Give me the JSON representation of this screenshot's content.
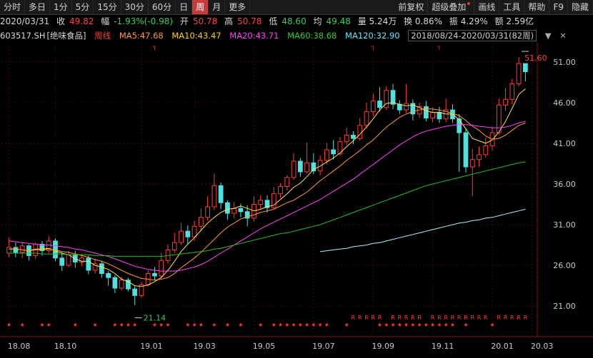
{
  "toolbar": {
    "periods": [
      "分时",
      "多日",
      "1分",
      "5分",
      "15分",
      "30分",
      "60分",
      "日",
      "周",
      "月",
      "更多"
    ],
    "active": "周",
    "right": [
      "前复权",
      "超级叠加",
      "画线",
      "工具",
      "帮助",
      "F9",
      "隐藏"
    ]
  },
  "info": {
    "date": "2020/03/31",
    "close_label": "收",
    "close": "49.82",
    "change_label": "幅",
    "change": "-1.93%(-0.98)",
    "open_label": "开",
    "open": "50.78",
    "high_label": "高",
    "high": "50.78",
    "low_label": "低",
    "low": "48.60",
    "avg_label": "均",
    "avg": "49.48",
    "volume": "量 5.24万",
    "turnover": "换 0.86%",
    "amplitude": "振 4.29%",
    "amount": "额 2.59亿"
  },
  "ma": {
    "code": "603517.SH",
    "name": "[绝味食品]",
    "period": "周线",
    "ma5": "MA5:47.68",
    "ma10": "MA10:43.47",
    "ma20": "MA20:43.71",
    "ma60": "MA60:38.68",
    "ma120": "MA120:32.90",
    "range": "2018/08/24-2020/03/31(82周)"
  },
  "colors": {
    "up": "#ff3b3b",
    "down": "#4fe0e0",
    "ma5": "#ffe14a",
    "ma10": "#ff9b2f",
    "ma20": "#ff44ff",
    "ma60": "#1fbf1f",
    "ma120": "#b0f4ff",
    "grid": "#3a0b0b"
  },
  "chart_data": {
    "type": "candlestick",
    "ylim": [
      19,
      53
    ],
    "y_ticks": [
      "51.00",
      "46.00",
      "41.00",
      "36.00",
      "31.00",
      "26.00",
      "21.00"
    ],
    "x_ticks": [
      "18.08",
      "18.10",
      "19.01",
      "19.03",
      "19.05",
      "19.07",
      "19.09",
      "19.11",
      "20.01",
      "20.03"
    ],
    "max_label": "51.60",
    "min_label": "21.14",
    "candles": [
      [
        27.5,
        28.2,
        29.4,
        27.0
      ],
      [
        28.2,
        27.6,
        28.8,
        27.0
      ],
      [
        27.6,
        28.4,
        28.9,
        26.9
      ],
      [
        28.4,
        27.2,
        28.6,
        26.6
      ],
      [
        27.2,
        28.6,
        28.8,
        26.8
      ],
      [
        28.6,
        27.8,
        29.0,
        27.2
      ],
      [
        27.8,
        29.0,
        29.6,
        27.5
      ],
      [
        29.0,
        26.9,
        29.3,
        26.5
      ],
      [
        26.9,
        26.0,
        27.6,
        25.3
      ],
      [
        26.0,
        27.3,
        27.8,
        25.8
      ],
      [
        27.3,
        26.4,
        27.8,
        25.7
      ],
      [
        26.4,
        26.9,
        27.4,
        25.9
      ],
      [
        26.9,
        25.4,
        27.2,
        24.9
      ],
      [
        25.4,
        26.2,
        26.8,
        25.0
      ],
      [
        26.2,
        25.0,
        26.5,
        24.5
      ],
      [
        25.0,
        24.5,
        25.3,
        23.5
      ],
      [
        24.5,
        23.2,
        24.8,
        22.6
      ],
      [
        23.2,
        24.2,
        24.6,
        22.9
      ],
      [
        24.2,
        23.1,
        24.5,
        22.8
      ],
      [
        23.1,
        22.3,
        23.5,
        21.1
      ],
      [
        22.3,
        23.6,
        24.0,
        22.0
      ],
      [
        23.6,
        25.0,
        25.4,
        23.4
      ],
      [
        25.0,
        24.7,
        25.8,
        24.2
      ],
      [
        24.7,
        26.6,
        27.5,
        24.5
      ],
      [
        26.6,
        27.9,
        28.6,
        26.2
      ],
      [
        27.9,
        28.8,
        30.0,
        27.5
      ],
      [
        28.8,
        30.2,
        31.2,
        28.5
      ],
      [
        30.2,
        29.5,
        30.9,
        28.6
      ],
      [
        29.5,
        30.8,
        31.5,
        29.0
      ],
      [
        30.8,
        31.9,
        33.0,
        30.2
      ],
      [
        31.9,
        33.2,
        34.5,
        31.5
      ],
      [
        33.2,
        35.8,
        37.3,
        32.8
      ],
      [
        35.8,
        33.7,
        36.2,
        32.9
      ],
      [
        33.7,
        32.4,
        34.0,
        31.6
      ],
      [
        32.4,
        33.0,
        33.8,
        31.8
      ],
      [
        33.0,
        32.6,
        33.6,
        31.9
      ],
      [
        32.6,
        31.8,
        33.4,
        30.8
      ],
      [
        31.8,
        33.5,
        34.5,
        31.4
      ],
      [
        33.5,
        34.0,
        34.6,
        32.9
      ],
      [
        34.0,
        33.1,
        34.6,
        32.5
      ],
      [
        33.1,
        34.8,
        35.6,
        32.9
      ],
      [
        34.8,
        35.7,
        36.1,
        34.3
      ],
      [
        35.7,
        36.8,
        37.1,
        35.2
      ],
      [
        36.8,
        38.8,
        39.8,
        36.5
      ],
      [
        38.8,
        37.5,
        39.2,
        36.9
      ],
      [
        37.5,
        38.6,
        41.1,
        37.3
      ],
      [
        38.6,
        37.6,
        39.8,
        37.2
      ],
      [
        37.6,
        38.9,
        39.5,
        37.1
      ],
      [
        38.9,
        40.2,
        41.0,
        38.4
      ],
      [
        40.2,
        39.7,
        41.4,
        39.0
      ],
      [
        39.7,
        41.2,
        41.8,
        39.5
      ],
      [
        41.2,
        42.0,
        42.9,
        40.8
      ],
      [
        42.0,
        41.6,
        42.5,
        40.9
      ],
      [
        41.6,
        43.2,
        44.1,
        41.3
      ],
      [
        43.2,
        44.9,
        46.0,
        42.8
      ],
      [
        44.9,
        46.2,
        47.1,
        44.3
      ],
      [
        46.2,
        45.4,
        47.9,
        44.9
      ],
      [
        45.4,
        47.5,
        48.0,
        45.1
      ],
      [
        47.5,
        45.8,
        48.3,
        45.2
      ],
      [
        45.8,
        45.1,
        46.3,
        44.6
      ],
      [
        45.1,
        45.9,
        48.3,
        44.7
      ],
      [
        45.9,
        44.6,
        46.4,
        43.8
      ],
      [
        44.6,
        45.5,
        46.0,
        44.1
      ],
      [
        45.5,
        44.1,
        46.2,
        43.7
      ],
      [
        44.1,
        44.8,
        45.4,
        43.6
      ],
      [
        44.8,
        44.0,
        45.5,
        43.5
      ],
      [
        44.0,
        45.1,
        46.5,
        43.6
      ],
      [
        45.1,
        44.0,
        45.8,
        43.5
      ],
      [
        44.0,
        42.3,
        44.6,
        37.5
      ],
      [
        42.3,
        38.1,
        42.8,
        37.4
      ],
      [
        38.1,
        39.0,
        40.3,
        34.5
      ],
      [
        39.0,
        39.6,
        40.6,
        38.1
      ],
      [
        39.6,
        40.7,
        41.7,
        39.2
      ],
      [
        40.7,
        42.3,
        43.0,
        40.1
      ],
      [
        42.3,
        45.7,
        46.5,
        42.0
      ],
      [
        45.7,
        46.4,
        47.8,
        45.0
      ],
      [
        46.4,
        48.3,
        48.9,
        45.8
      ],
      [
        48.3,
        50.8,
        51.6,
        48.0
      ],
      [
        50.8,
        49.8,
        50.8,
        48.6
      ]
    ],
    "series": [
      {
        "name": "MA5",
        "values": [
          28.0,
          28.0,
          27.9,
          27.8,
          28.0,
          28.0,
          28.1,
          27.8,
          27.5,
          27.3,
          26.8,
          26.5,
          26.5,
          26.0,
          25.8,
          25.5,
          25.0,
          24.3,
          24.0,
          23.5,
          23.4,
          23.6,
          24.0,
          24.5,
          25.4,
          26.5,
          27.7,
          28.6,
          29.4,
          30.3,
          31.2,
          31.9,
          32.5,
          32.9,
          33.0,
          33.3,
          33.0,
          32.7,
          32.9,
          33.2,
          33.4,
          34.1,
          34.8,
          35.6,
          36.1,
          36.9,
          37.8,
          38.2,
          38.7,
          39.2,
          39.8,
          40.6,
          41.3,
          42.1,
          43.0,
          44.0,
          45.1,
          45.9,
          46.0,
          45.8,
          45.6,
          45.7,
          45.4,
          45.0,
          44.8,
          44.8,
          44.6,
          44.6,
          43.9,
          42.8,
          41.6,
          41.3,
          41.0,
          41.4,
          42.4,
          43.7,
          45.3,
          47.0,
          47.7
        ]
      },
      {
        "name": "MA10",
        "values": [
          28.0,
          28.0,
          27.9,
          27.8,
          27.9,
          27.9,
          28.0,
          27.9,
          27.7,
          27.6,
          27.4,
          27.2,
          27.0,
          26.7,
          26.5,
          26.2,
          25.8,
          25.4,
          25.0,
          24.7,
          24.4,
          24.3,
          24.2,
          24.3,
          24.5,
          25.0,
          25.7,
          26.3,
          26.9,
          27.6,
          28.4,
          29.2,
          30.0,
          30.7,
          31.2,
          31.7,
          32.0,
          32.2,
          32.5,
          32.7,
          32.9,
          33.3,
          33.7,
          34.0,
          34.5,
          35.0,
          35.7,
          36.4,
          37.0,
          37.6,
          38.2,
          38.9,
          39.5,
          40.1,
          40.8,
          41.4,
          42.2,
          43.0,
          43.6,
          44.2,
          44.6,
          44.9,
          45.1,
          45.3,
          45.2,
          45.1,
          44.9,
          44.7,
          44.4,
          43.8,
          43.1,
          42.6,
          41.9,
          41.5,
          41.6,
          42.0,
          42.6,
          43.2,
          43.5
        ]
      },
      {
        "name": "MA20",
        "values": [
          29.0,
          28.9,
          28.8,
          28.7,
          28.6,
          28.5,
          28.5,
          28.4,
          28.3,
          28.2,
          28.0,
          27.9,
          27.7,
          27.5,
          27.3,
          27.1,
          26.8,
          26.5,
          26.2,
          25.9,
          25.7,
          25.5,
          25.4,
          25.3,
          25.3,
          25.3,
          25.4,
          25.6,
          25.8,
          26.1,
          26.5,
          27.0,
          27.5,
          28.0,
          28.5,
          29.0,
          29.5,
          30.0,
          30.5,
          30.9,
          31.3,
          31.7,
          32.1,
          32.5,
          32.9,
          33.3,
          33.7,
          34.1,
          34.6,
          35.1,
          35.6,
          36.1,
          36.6,
          37.2,
          37.8,
          38.4,
          39.0,
          39.6,
          40.2,
          40.8,
          41.3,
          41.8,
          42.2,
          42.5,
          42.7,
          42.9,
          43.1,
          43.2,
          43.3,
          43.3,
          43.2,
          43.1,
          43.0,
          42.9,
          42.9,
          43.0,
          43.2,
          43.5,
          43.7
        ]
      },
      {
        "name": "MA60",
        "values": [
          27.5,
          27.5,
          27.5,
          27.5,
          27.5,
          27.4,
          27.4,
          27.4,
          27.4,
          27.3,
          27.3,
          27.3,
          27.3,
          27.2,
          27.2,
          27.2,
          27.1,
          27.1,
          27.1,
          27.1,
          27.1,
          27.1,
          27.1,
          27.1,
          27.2,
          27.3,
          27.4,
          27.5,
          27.6,
          27.7,
          27.8,
          28.0,
          28.1,
          28.3,
          28.5,
          28.7,
          28.9,
          29.1,
          29.3,
          29.5,
          29.7,
          29.9,
          30.0,
          30.2,
          30.4,
          30.6,
          30.8,
          31.0,
          31.3,
          31.6,
          31.9,
          32.2,
          32.5,
          32.8,
          33.1,
          33.4,
          33.7,
          34.0,
          34.3,
          34.6,
          34.9,
          35.2,
          35.5,
          35.8,
          36.0,
          36.2,
          36.4,
          36.6,
          36.8,
          37.0,
          37.2,
          37.4,
          37.6,
          37.8,
          38.0,
          38.2,
          38.4,
          38.6,
          38.7
        ]
      },
      {
        "name": "MA120",
        "values": [
          null,
          null,
          null,
          null,
          null,
          null,
          null,
          null,
          null,
          null,
          null,
          null,
          null,
          null,
          null,
          null,
          null,
          null,
          null,
          null,
          null,
          null,
          null,
          null,
          null,
          null,
          null,
          null,
          null,
          null,
          null,
          null,
          null,
          null,
          null,
          null,
          null,
          null,
          null,
          null,
          null,
          null,
          null,
          null,
          null,
          null,
          null,
          27.7,
          27.8,
          27.9,
          28.0,
          28.1,
          28.3,
          28.4,
          28.5,
          28.7,
          28.8,
          29.0,
          29.2,
          29.4,
          29.6,
          29.8,
          30.0,
          30.2,
          30.4,
          30.6,
          30.8,
          31.0,
          31.2,
          31.3,
          31.5,
          31.6,
          31.8,
          31.9,
          32.1,
          32.3,
          32.5,
          32.7,
          32.9
        ]
      }
    ],
    "markers_r": "RRRRR RRRR RRRRRRRR RRRRR R R R",
    "markers_star": "★"
  }
}
